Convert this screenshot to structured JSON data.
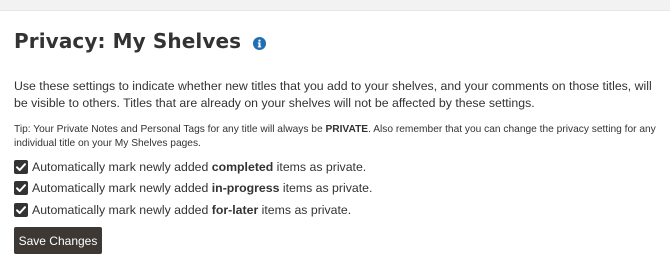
{
  "header": {
    "title": "Privacy: My Shelves",
    "info_icon": "info-circle-icon"
  },
  "intro_text": "Use these settings to indicate whether new titles that you add to your shelves, and your comments on those titles, will be visible to others. Titles that are already on your shelves will not be affected by these settings.",
  "tip": {
    "before": "Tip: Your Private Notes and Personal Tags for any title will always be ",
    "emphasis": "PRIVATE",
    "after": ". Also remember that you can change the privacy setting for any individual title on your My Shelves pages."
  },
  "options": [
    {
      "prefix": "Automatically mark newly added ",
      "emphasis": "completed",
      "suffix": " items as private.",
      "checked": true
    },
    {
      "prefix": "Automatically mark newly added ",
      "emphasis": "in-progress",
      "suffix": " items as private.",
      "checked": true
    },
    {
      "prefix": "Automatically mark newly added ",
      "emphasis": "for-later",
      "suffix": " items as private.",
      "checked": true
    }
  ],
  "save_button": "Save Changes",
  "colors": {
    "text": "#333333",
    "info_icon": "#1f6fb2",
    "button_bg": "#3d3833",
    "checkbox_fill": "#333333"
  }
}
